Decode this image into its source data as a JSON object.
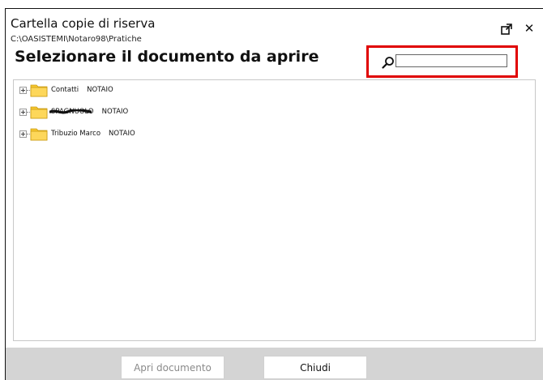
{
  "window": {
    "title": "Cartella copie di riserva",
    "path": "C:\\OASISTEMI\\Notaro98\\Pratiche",
    "heading": "Selezionare il documento da aprire"
  },
  "search": {
    "value": "",
    "icon": "search-icon",
    "highlight_color": "#e00000"
  },
  "tree": {
    "items": [
      {
        "name": "Contatti",
        "tag": "NOTAIO",
        "icon": "folder-icon",
        "redacted": false
      },
      {
        "name": "SPAGNUOLO",
        "tag": "NOTAIO",
        "icon": "folder-icon",
        "redacted": true
      },
      {
        "name": "Tribuzio Marco",
        "tag": "NOTAIO",
        "icon": "folder-icon",
        "redacted": false
      }
    ]
  },
  "footer": {
    "open_label": "Apri documento",
    "close_label": "Chiudi"
  },
  "colors": {
    "footer_bg": "#d4d4d4",
    "folder_fill": "#f7c72f",
    "disabled_text": "#8a8a8a"
  }
}
